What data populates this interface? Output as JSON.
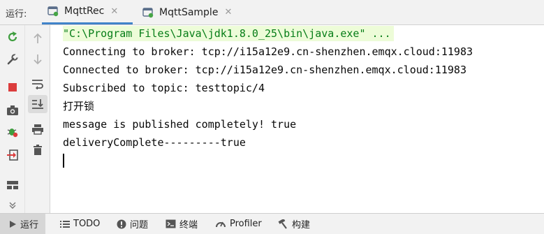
{
  "header": {
    "run_label": "运行:",
    "tabs": [
      {
        "label": "MqttRec",
        "close": "✕",
        "active": true
      },
      {
        "label": "MqttSample",
        "close": "✕",
        "active": false
      }
    ]
  },
  "console": {
    "lines": [
      "\"C:\\Program Files\\Java\\jdk1.8.0_25\\bin\\java.exe\" ...",
      "Connecting to broker: tcp://i15a12e9.cn-shenzhen.emqx.cloud:11983",
      "Connected to broker: tcp://i15a12e9.cn-shenzhen.emqx.cloud:11983",
      "Subscribed to topic: testtopic/4",
      "打开锁",
      "message is published completely! true",
      "deliveryComplete---------true"
    ]
  },
  "bottom": {
    "tools": [
      "运行",
      "TODO",
      "问题",
      "终端",
      "Profiler",
      "构建"
    ]
  },
  "colors": {
    "accent": "#4083c9",
    "command_text": "#067d17",
    "command_bg": "#edfcd8",
    "rerun": "#3f9e3f",
    "stop": "#db3c3c"
  }
}
